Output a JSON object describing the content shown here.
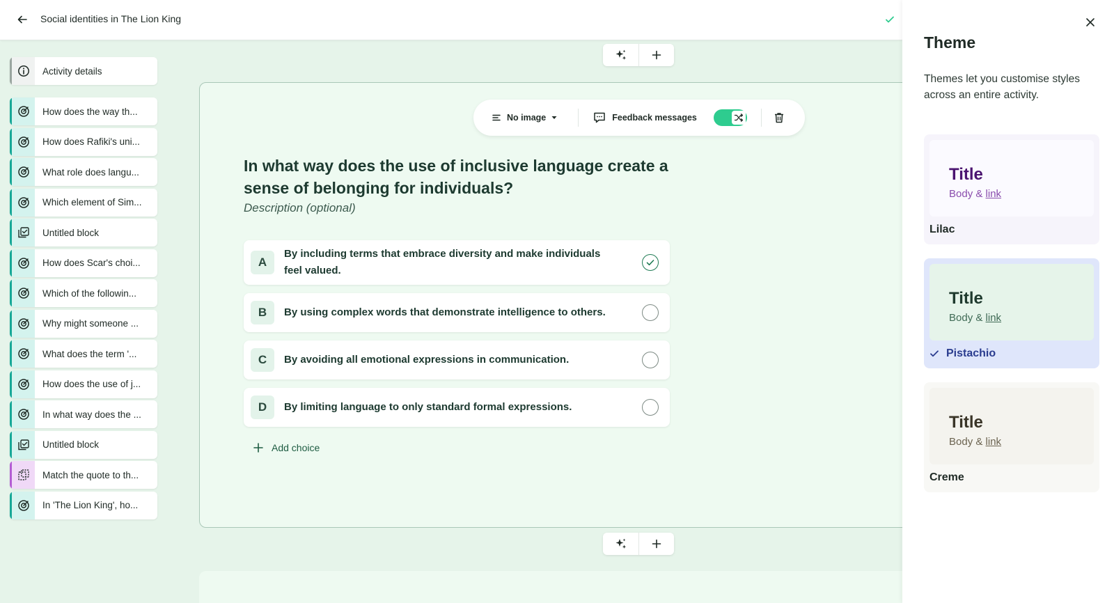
{
  "header": {
    "title": "Social identities in The Lion King"
  },
  "sidebar": {
    "details_label": "Activity details",
    "items": [
      {
        "label": "How does the way th...",
        "icon": "target-icon",
        "color": "teal"
      },
      {
        "label": "How does Rafiki's uni...",
        "icon": "target-icon",
        "color": "teal"
      },
      {
        "label": "What role does langu...",
        "icon": "target-icon",
        "color": "teal"
      },
      {
        "label": "Which element of Sim...",
        "icon": "target-icon",
        "color": "teal"
      },
      {
        "label": "Untitled block",
        "icon": "checklist-icon",
        "color": "teal"
      },
      {
        "label": "How does Scar's choi...",
        "icon": "target-icon",
        "color": "teal"
      },
      {
        "label": "Which of the followin...",
        "icon": "target-icon",
        "color": "teal"
      },
      {
        "label": "Why might someone ...",
        "icon": "target-icon",
        "color": "teal"
      },
      {
        "label": "What does the term '...",
        "icon": "target-icon",
        "color": "teal"
      },
      {
        "label": "How does the use of j...",
        "icon": "target-icon",
        "color": "teal"
      },
      {
        "label": "In what way does the ...",
        "icon": "target-icon",
        "color": "teal"
      },
      {
        "label": "Untitled block",
        "icon": "checklist-icon",
        "color": "teal"
      },
      {
        "label": "Match the quote to th...",
        "icon": "match-icon",
        "color": "purple"
      },
      {
        "label": "In 'The Lion King', ho...",
        "icon": "target-icon",
        "color": "teal"
      }
    ]
  },
  "toolbar": {
    "image_label": "No image",
    "feedback_label": "Feedback messages"
  },
  "question": {
    "title": "In what way does the use of inclusive language create a sense of belonging for individuals?",
    "description": "Description (optional)",
    "choices": [
      {
        "letter": "A",
        "text": "By including terms that embrace diversity and make individuals feel valued.",
        "correct": true
      },
      {
        "letter": "B",
        "text": "By using complex words that demonstrate intelligence to others.",
        "correct": false
      },
      {
        "letter": "C",
        "text": "By avoiding all emotional expressions in communication.",
        "correct": false
      },
      {
        "letter": "D",
        "text": "By limiting language to only standard formal expressions.",
        "correct": false
      }
    ],
    "add_choice_label": "Add choice"
  },
  "theme_panel": {
    "title": "Theme",
    "description": "Themes let you customise styles across an entire activity.",
    "themes": [
      {
        "name": "Lilac",
        "preview_title": "Title",
        "preview_body": "Body &",
        "preview_link": "link",
        "selected": false,
        "colors": {
          "card": "#f6f4fb",
          "preview": "#fbfaff",
          "title": "#4b1470",
          "body": "#8a4dad"
        }
      },
      {
        "name": "Pistachio",
        "preview_title": "Title",
        "preview_body": "Body &",
        "preview_link": "link",
        "selected": true,
        "colors": {
          "card": "#dfe6fb",
          "preview": "#e6f4ea",
          "title": "#1f3a2e",
          "body": "#3f6a55"
        }
      },
      {
        "name": "Creme",
        "preview_title": "Title",
        "preview_body": "Body &",
        "preview_link": "link",
        "selected": false,
        "colors": {
          "card": "#f8f8f5",
          "preview": "#f4f3ee",
          "title": "#3a3528",
          "body": "#6b6350"
        }
      }
    ]
  }
}
